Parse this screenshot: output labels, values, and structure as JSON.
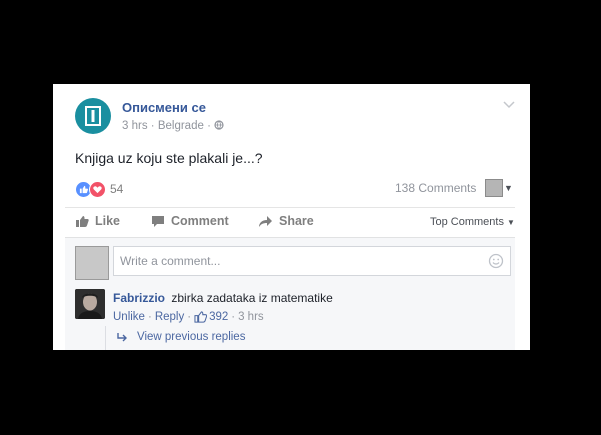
{
  "post": {
    "page_name": "Описмени се",
    "time": "3 hrs",
    "location": "Belgrade",
    "text": "Knjiga uz koju ste plakali je...?",
    "reactions_count": "54",
    "comments_count": "138 Comments"
  },
  "actions": {
    "like": "Like",
    "comment": "Comment",
    "share": "Share",
    "sort": "Top Comments"
  },
  "comment_box": {
    "placeholder": "Write a comment..."
  },
  "comment": {
    "author": "Fabrizzio",
    "text": "zbirka zadataka iz matematike",
    "unlike": "Unlike",
    "reply": "Reply",
    "likes": "392",
    "time": "3 hrs"
  },
  "replies": {
    "view_previous": "View previous replies"
  },
  "colors": {
    "page_background": "#000000",
    "card_background": "#ffffff",
    "link_blue": "#365899",
    "like_blue": "#5890ff",
    "love_red": "#f25268",
    "logo_teal": "#1a8fa0"
  },
  "icons": {
    "page_logo": "book-logo-icon",
    "globe": "globe-icon",
    "like": "thumbs-up-icon",
    "love": "heart-icon",
    "comment": "speech-bubble-icon",
    "share": "share-arrow-icon",
    "emoji": "smiley-icon",
    "reply_arrow": "reply-arrow-icon"
  }
}
